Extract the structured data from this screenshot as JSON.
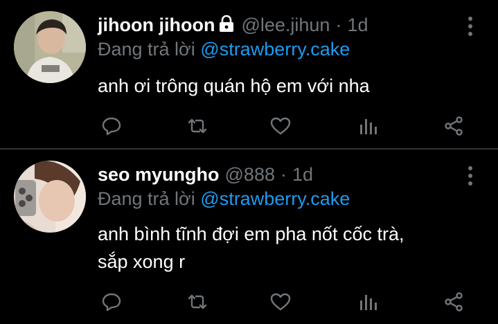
{
  "tweets": [
    {
      "display_name": "jihoon jihoon",
      "handle": "@lee.jihun",
      "separator": "·",
      "time": "1d",
      "locked": true,
      "reply_prefix": "Đang trả lời",
      "reply_to": "@strawberry.cake",
      "text": "anh ơi trông quán hộ em với nha",
      "icons": [
        "lock-icon",
        "more-icon",
        "reply-icon",
        "retweet-icon",
        "like-icon",
        "views-icon",
        "share-icon"
      ]
    },
    {
      "display_name": "seo myungho",
      "handle": "@888",
      "separator": "·",
      "time": "1d",
      "locked": false,
      "reply_prefix": "Đang trả lời",
      "reply_to": "@strawberry.cake",
      "text_lines": [
        "anh bình tĩnh đợi em pha nốt cốc trà,",
        "sắp xong r"
      ],
      "icons": [
        "more-icon",
        "reply-icon",
        "retweet-icon",
        "like-icon",
        "views-icon",
        "share-icon"
      ]
    }
  ],
  "colors": {
    "background": "#000000",
    "text_primary": "#ffffff",
    "text_secondary": "#71767b",
    "accent": "#1d9bf0",
    "divider": "#2f3336"
  }
}
